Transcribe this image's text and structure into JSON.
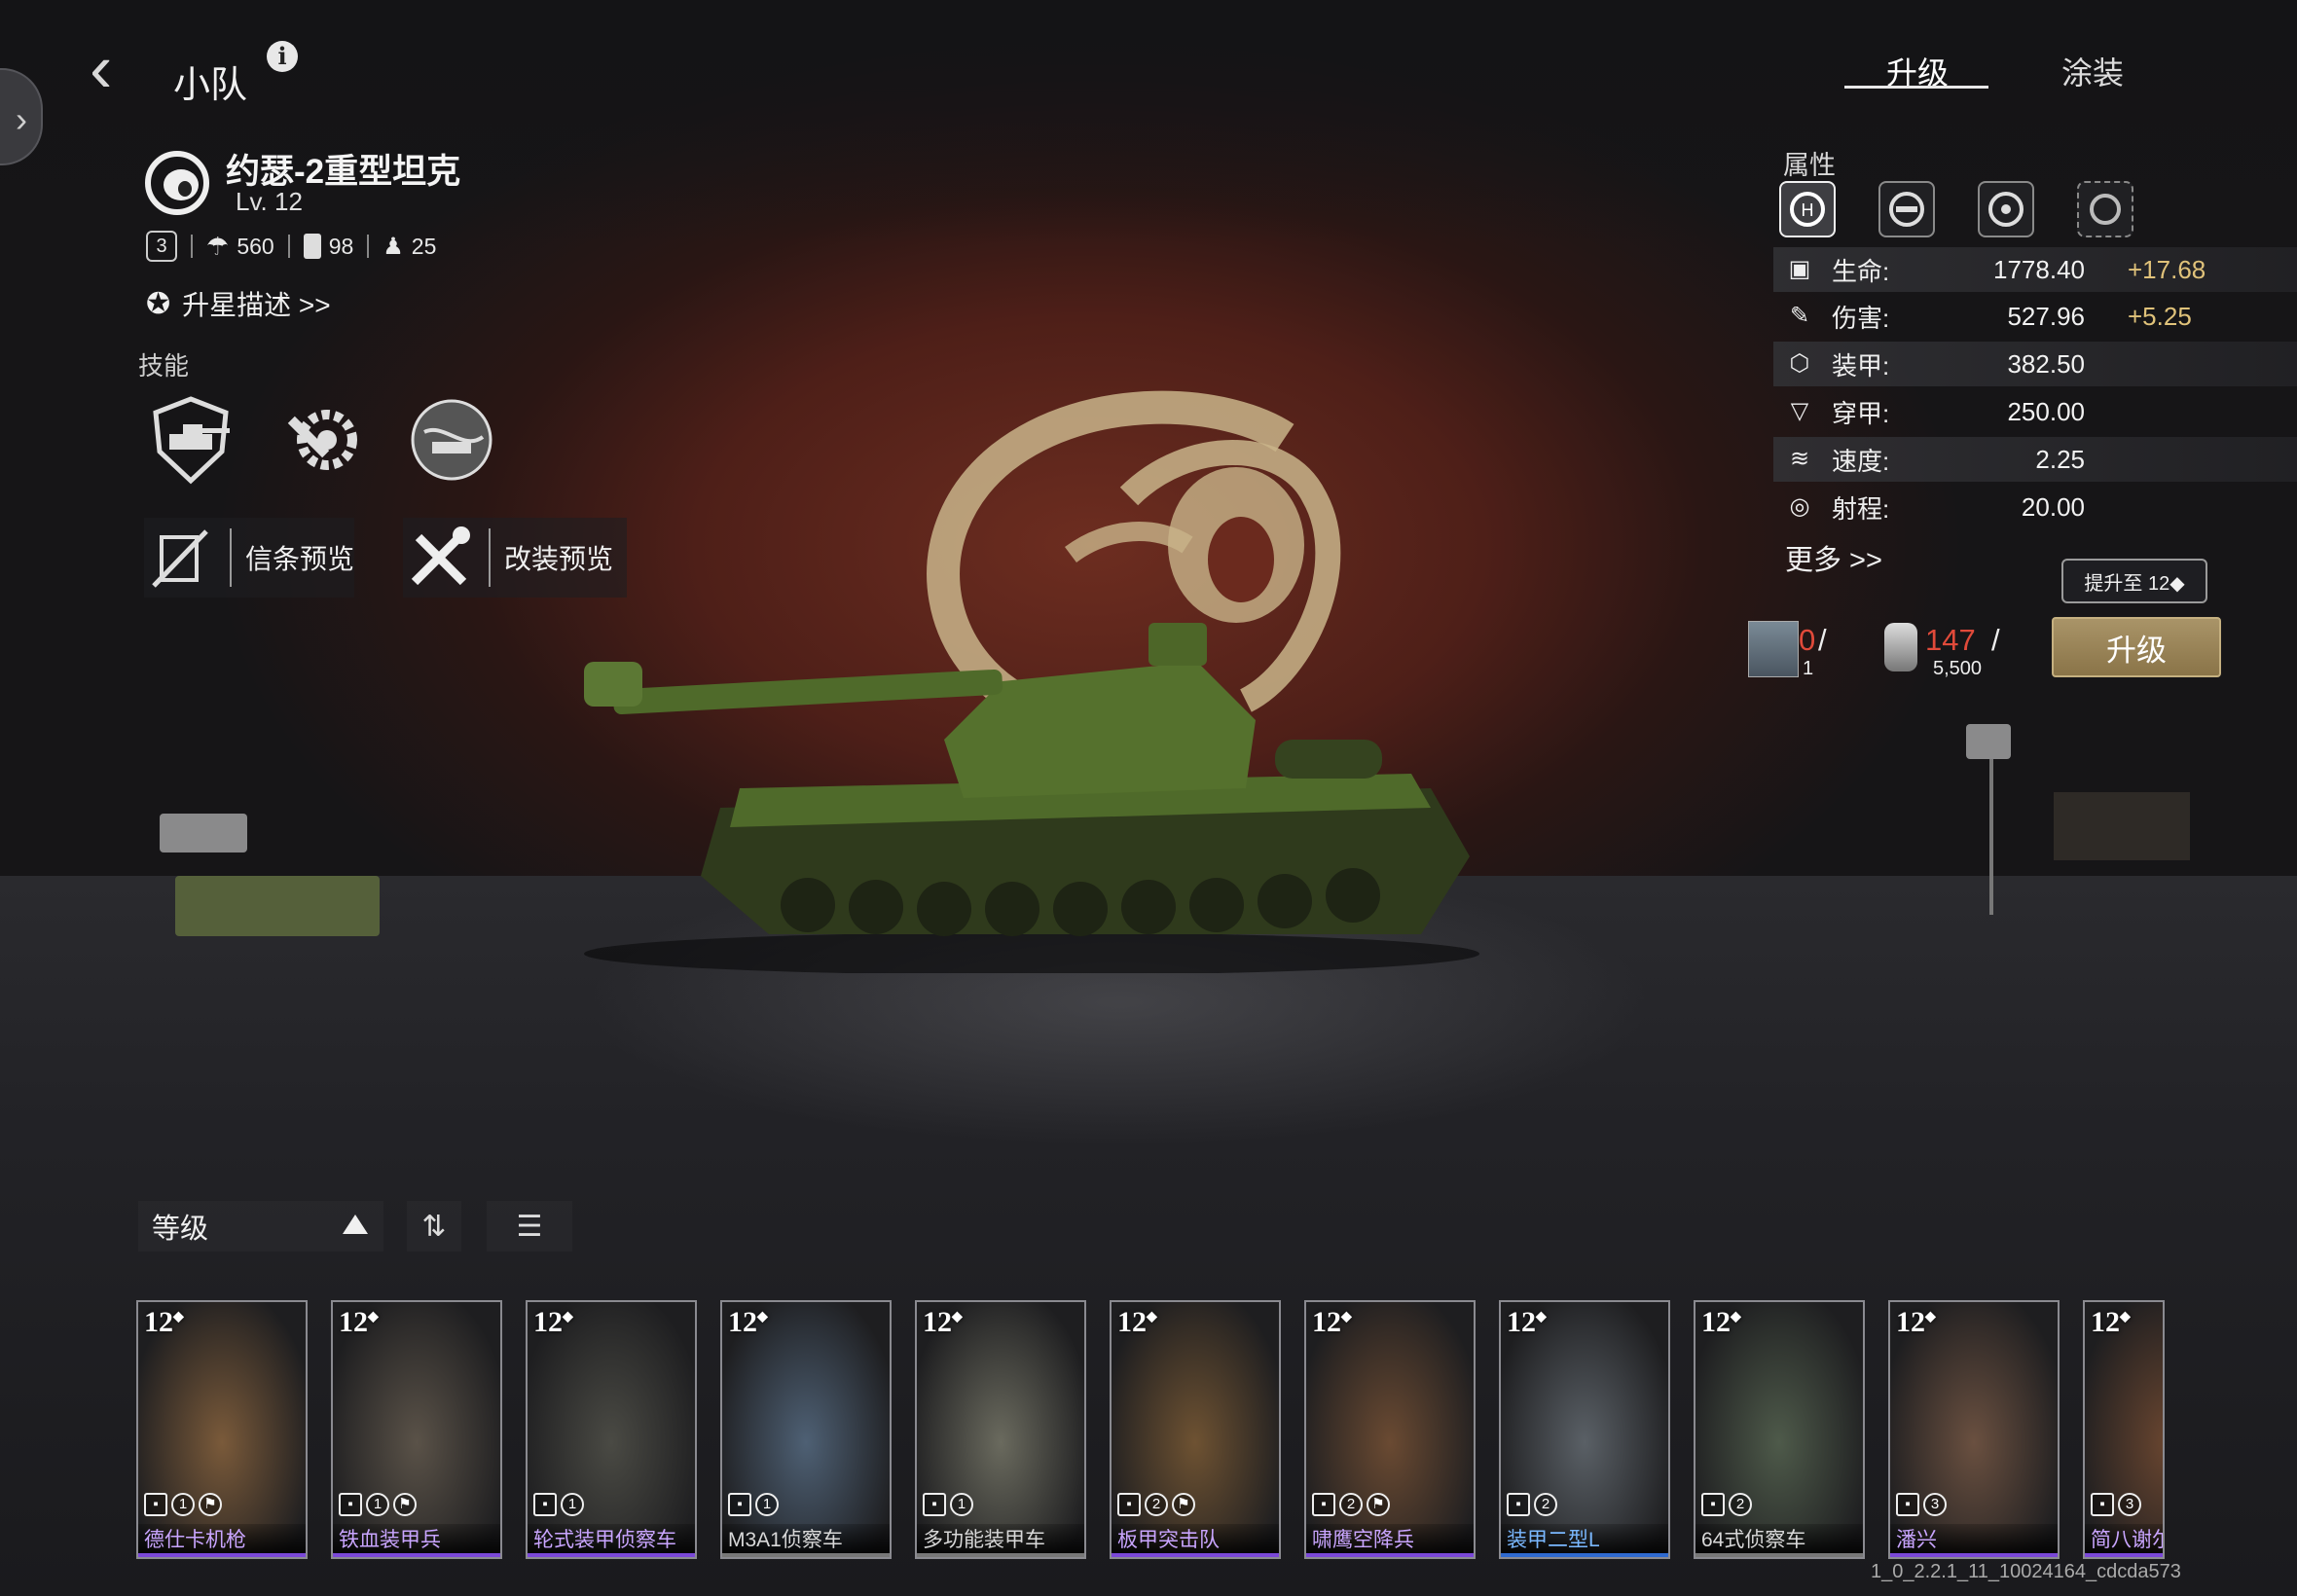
{
  "header": {
    "title": "小队",
    "info_label": "i"
  },
  "tabs": [
    {
      "label": "升级",
      "active": true
    },
    {
      "label": "涂装",
      "active": false
    }
  ],
  "unit": {
    "name": "约瑟-2重型坦克",
    "level": "Lv. 12",
    "rank_badge": "3",
    "stats": {
      "parachute": "560",
      "fuel": "98",
      "soldier": "25"
    },
    "star_link": "升星描述 >>"
  },
  "skills": {
    "label": "技能",
    "items": [
      {
        "icon": "tank-shield-skill-icon"
      },
      {
        "icon": "repair-gear-skill-icon"
      },
      {
        "icon": "globe-tank-skill-icon"
      }
    ]
  },
  "previews": [
    {
      "label": "信条预览",
      "icon": "creed-icon"
    },
    {
      "label": "改装预览",
      "icon": "tools-icon"
    }
  ],
  "attributes": {
    "label": "属性",
    "tab_icons": [
      "health-attr-icon",
      "armor-attr-icon",
      "target-attr-icon",
      "cycle-attr-icon"
    ],
    "rows": [
      {
        "icon": "health-icon",
        "name": "生命:",
        "value": "1778.40",
        "bonus": "+17.68"
      },
      {
        "icon": "damage-icon",
        "name": "伤害:",
        "value": "527.96",
        "bonus": "+5.25"
      },
      {
        "icon": "armor-icon",
        "name": "装甲:",
        "value": "382.50",
        "bonus": ""
      },
      {
        "icon": "penetration-icon",
        "name": "穿甲:",
        "value": "250.00",
        "bonus": ""
      },
      {
        "icon": "speed-icon",
        "name": "速度:",
        "value": "2.25",
        "bonus": ""
      },
      {
        "icon": "range-icon",
        "name": "射程:",
        "value": "20.00",
        "bonus": ""
      }
    ],
    "more": "更多 >>"
  },
  "upgrade": {
    "tooltip": "提升至 12◆",
    "cost_cards": {
      "have": "0",
      "need": "1"
    },
    "cost_metal": {
      "have": "147",
      "need": "5,500"
    },
    "button": "升级"
  },
  "sort": {
    "label": "等级",
    "order_icon": "ascending-triangle-icon",
    "swap_icon": "sort-swap-icon",
    "filter_icon": "filter-sliders-icon"
  },
  "cards": [
    {
      "level": "12",
      "badge": "1",
      "name": "德仕卡机枪",
      "rarity": "purple",
      "flag": true
    },
    {
      "level": "12",
      "badge": "1",
      "name": "铁血装甲兵",
      "rarity": "purple",
      "flag": true
    },
    {
      "level": "12",
      "badge": "1",
      "name": "轮式装甲侦察车",
      "rarity": "purple",
      "flag": false
    },
    {
      "level": "12",
      "badge": "1",
      "name": "M3A1侦察车",
      "rarity": "gray",
      "flag": false
    },
    {
      "level": "12",
      "badge": "1",
      "name": "多功能装甲车",
      "rarity": "gray",
      "flag": false
    },
    {
      "level": "12",
      "badge": "2",
      "name": "板甲突击队",
      "rarity": "purple",
      "flag": true
    },
    {
      "level": "12",
      "badge": "2",
      "name": "啸鹰空降兵",
      "rarity": "purple",
      "flag": true
    },
    {
      "level": "12",
      "badge": "2",
      "name": "装甲二型L",
      "rarity": "blue",
      "flag": false
    },
    {
      "level": "12",
      "badge": "2",
      "name": "64式侦察车",
      "rarity": "gray",
      "flag": false
    },
    {
      "level": "12",
      "badge": "3",
      "name": "潘兴",
      "rarity": "purple",
      "flag": false
    },
    {
      "level": "12",
      "badge": "3",
      "name": "简八谢尔",
      "rarity": "purple",
      "flag": false
    }
  ],
  "version": "1_0_2.2.1_11_10024164_cdcda573"
}
